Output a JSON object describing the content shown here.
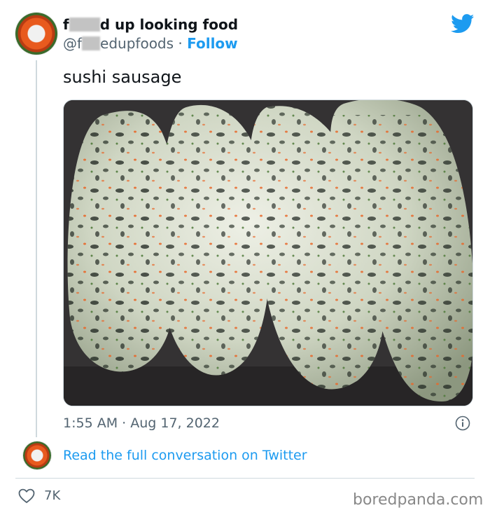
{
  "tweet": {
    "display_name_start": "f",
    "display_name_end": "d up looking food",
    "handle_start": "@f",
    "handle_end": "edupfoods",
    "separator": " · ",
    "follow_label": "Follow",
    "text": "sushi sausage",
    "time": "1:55 AM",
    "date_separator": " · ",
    "date": "Aug 17, 2022",
    "read_link": "Read the full conversation on Twitter",
    "likes": "7K"
  },
  "icons": {
    "brand": "twitter-bird-icon",
    "info": "info-icon",
    "like": "heart-icon"
  },
  "colors": {
    "accent": "#1d9bf0",
    "muted": "#536471",
    "text": "#0f1419"
  },
  "watermark": "boredpanda.com"
}
